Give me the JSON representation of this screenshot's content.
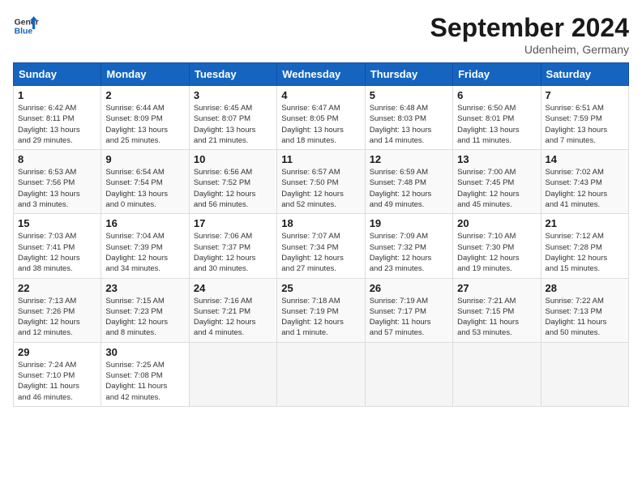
{
  "header": {
    "logo_general": "General",
    "logo_blue": "Blue",
    "month_title": "September 2024",
    "location": "Udenheim, Germany"
  },
  "weekdays": [
    "Sunday",
    "Monday",
    "Tuesday",
    "Wednesday",
    "Thursday",
    "Friday",
    "Saturday"
  ],
  "weeks": [
    [
      {
        "day": "1",
        "info": "Sunrise: 6:42 AM\nSunset: 8:11 PM\nDaylight: 13 hours\nand 29 minutes."
      },
      {
        "day": "2",
        "info": "Sunrise: 6:44 AM\nSunset: 8:09 PM\nDaylight: 13 hours\nand 25 minutes."
      },
      {
        "day": "3",
        "info": "Sunrise: 6:45 AM\nSunset: 8:07 PM\nDaylight: 13 hours\nand 21 minutes."
      },
      {
        "day": "4",
        "info": "Sunrise: 6:47 AM\nSunset: 8:05 PM\nDaylight: 13 hours\nand 18 minutes."
      },
      {
        "day": "5",
        "info": "Sunrise: 6:48 AM\nSunset: 8:03 PM\nDaylight: 13 hours\nand 14 minutes."
      },
      {
        "day": "6",
        "info": "Sunrise: 6:50 AM\nSunset: 8:01 PM\nDaylight: 13 hours\nand 11 minutes."
      },
      {
        "day": "7",
        "info": "Sunrise: 6:51 AM\nSunset: 7:59 PM\nDaylight: 13 hours\nand 7 minutes."
      }
    ],
    [
      {
        "day": "8",
        "info": "Sunrise: 6:53 AM\nSunset: 7:56 PM\nDaylight: 13 hours\nand 3 minutes."
      },
      {
        "day": "9",
        "info": "Sunrise: 6:54 AM\nSunset: 7:54 PM\nDaylight: 13 hours\nand 0 minutes."
      },
      {
        "day": "10",
        "info": "Sunrise: 6:56 AM\nSunset: 7:52 PM\nDaylight: 12 hours\nand 56 minutes."
      },
      {
        "day": "11",
        "info": "Sunrise: 6:57 AM\nSunset: 7:50 PM\nDaylight: 12 hours\nand 52 minutes."
      },
      {
        "day": "12",
        "info": "Sunrise: 6:59 AM\nSunset: 7:48 PM\nDaylight: 12 hours\nand 49 minutes."
      },
      {
        "day": "13",
        "info": "Sunrise: 7:00 AM\nSunset: 7:45 PM\nDaylight: 12 hours\nand 45 minutes."
      },
      {
        "day": "14",
        "info": "Sunrise: 7:02 AM\nSunset: 7:43 PM\nDaylight: 12 hours\nand 41 minutes."
      }
    ],
    [
      {
        "day": "15",
        "info": "Sunrise: 7:03 AM\nSunset: 7:41 PM\nDaylight: 12 hours\nand 38 minutes."
      },
      {
        "day": "16",
        "info": "Sunrise: 7:04 AM\nSunset: 7:39 PM\nDaylight: 12 hours\nand 34 minutes."
      },
      {
        "day": "17",
        "info": "Sunrise: 7:06 AM\nSunset: 7:37 PM\nDaylight: 12 hours\nand 30 minutes."
      },
      {
        "day": "18",
        "info": "Sunrise: 7:07 AM\nSunset: 7:34 PM\nDaylight: 12 hours\nand 27 minutes."
      },
      {
        "day": "19",
        "info": "Sunrise: 7:09 AM\nSunset: 7:32 PM\nDaylight: 12 hours\nand 23 minutes."
      },
      {
        "day": "20",
        "info": "Sunrise: 7:10 AM\nSunset: 7:30 PM\nDaylight: 12 hours\nand 19 minutes."
      },
      {
        "day": "21",
        "info": "Sunrise: 7:12 AM\nSunset: 7:28 PM\nDaylight: 12 hours\nand 15 minutes."
      }
    ],
    [
      {
        "day": "22",
        "info": "Sunrise: 7:13 AM\nSunset: 7:26 PM\nDaylight: 12 hours\nand 12 minutes."
      },
      {
        "day": "23",
        "info": "Sunrise: 7:15 AM\nSunset: 7:23 PM\nDaylight: 12 hours\nand 8 minutes."
      },
      {
        "day": "24",
        "info": "Sunrise: 7:16 AM\nSunset: 7:21 PM\nDaylight: 12 hours\nand 4 minutes."
      },
      {
        "day": "25",
        "info": "Sunrise: 7:18 AM\nSunset: 7:19 PM\nDaylight: 12 hours\nand 1 minute."
      },
      {
        "day": "26",
        "info": "Sunrise: 7:19 AM\nSunset: 7:17 PM\nDaylight: 11 hours\nand 57 minutes."
      },
      {
        "day": "27",
        "info": "Sunrise: 7:21 AM\nSunset: 7:15 PM\nDaylight: 11 hours\nand 53 minutes."
      },
      {
        "day": "28",
        "info": "Sunrise: 7:22 AM\nSunset: 7:13 PM\nDaylight: 11 hours\nand 50 minutes."
      }
    ],
    [
      {
        "day": "29",
        "info": "Sunrise: 7:24 AM\nSunset: 7:10 PM\nDaylight: 11 hours\nand 46 minutes."
      },
      {
        "day": "30",
        "info": "Sunrise: 7:25 AM\nSunset: 7:08 PM\nDaylight: 11 hours\nand 42 minutes."
      },
      {
        "day": "",
        "info": ""
      },
      {
        "day": "",
        "info": ""
      },
      {
        "day": "",
        "info": ""
      },
      {
        "day": "",
        "info": ""
      },
      {
        "day": "",
        "info": ""
      }
    ]
  ]
}
